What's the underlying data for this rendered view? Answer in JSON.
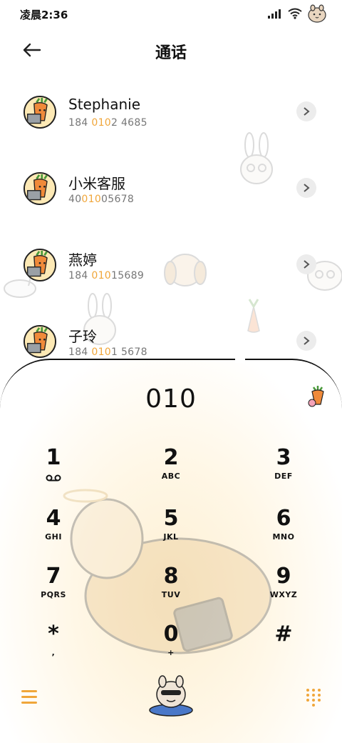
{
  "status_bar": {
    "time": "凌晨2:36",
    "icons": [
      "signal-icon",
      "wifi-icon",
      "mascot-avatar-icon"
    ]
  },
  "header": {
    "title": "通话",
    "back_icon": "arrow-left-icon"
  },
  "contacts": [
    {
      "name": "Stephanie",
      "number_pre": "184 ",
      "number_hl": "010",
      "number_post": "2 4685"
    },
    {
      "name": "小米客服",
      "number_pre": "40",
      "number_hl": "010",
      "number_post": "05678"
    },
    {
      "name": "燕婷",
      "number_pre": "184 ",
      "number_hl": "010",
      "number_post": "15689"
    },
    {
      "name": "子玲",
      "number_pre": "184 ",
      "number_hl": "010",
      "number_post": "1 5678"
    }
  ],
  "dialpad": {
    "input": "010",
    "keys": [
      {
        "digit": "1",
        "letters": ""
      },
      {
        "digit": "2",
        "letters": "ABC"
      },
      {
        "digit": "3",
        "letters": "DEF"
      },
      {
        "digit": "4",
        "letters": "GHI"
      },
      {
        "digit": "5",
        "letters": "JKL"
      },
      {
        "digit": "6",
        "letters": "MNO"
      },
      {
        "digit": "7",
        "letters": "PQRS"
      },
      {
        "digit": "8",
        "letters": "TUV"
      },
      {
        "digit": "9",
        "letters": "WXYZ"
      },
      {
        "digit": "*",
        "letters": ","
      },
      {
        "digit": "0",
        "letters": "+"
      },
      {
        "digit": "#",
        "letters": ""
      }
    ],
    "bottom_icons": [
      "menu-icon",
      "dial-mascot-icon",
      "keypad-grid-icon"
    ]
  },
  "colors": {
    "accent": "#f0a63a",
    "text": "#111111",
    "subtext": "#777777"
  }
}
